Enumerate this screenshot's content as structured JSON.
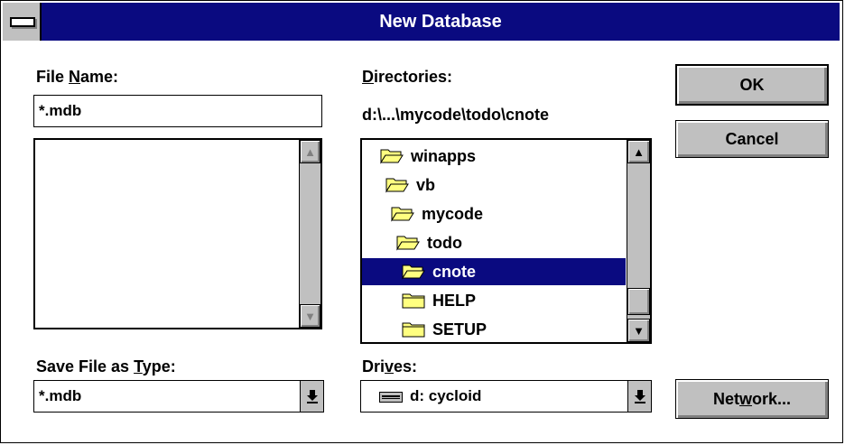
{
  "window": {
    "title": "New Database"
  },
  "file_name": {
    "label_pre": "File ",
    "label_key": "N",
    "label_post": "ame:",
    "value": "*.mdb",
    "files": []
  },
  "directories": {
    "label_key": "D",
    "label_post": "irectories:",
    "path": "d:\\...\\mycode\\todo\\cnote",
    "items": [
      {
        "name": "winapps",
        "icon": "open-folder-icon",
        "selected": false
      },
      {
        "name": "vb",
        "icon": "open-folder-icon",
        "selected": false
      },
      {
        "name": "mycode",
        "icon": "open-folder-icon",
        "selected": false
      },
      {
        "name": "todo",
        "icon": "open-folder-icon",
        "selected": false
      },
      {
        "name": "cnote",
        "icon": "open-folder-icon",
        "selected": true
      },
      {
        "name": "HELP",
        "icon": "closed-folder-icon",
        "selected": false
      },
      {
        "name": "SETUP",
        "icon": "closed-folder-icon",
        "selected": false
      }
    ]
  },
  "save_type": {
    "label_pre": "Save File as ",
    "label_key": "T",
    "label_post": "ype:",
    "value": "*.mdb"
  },
  "drives": {
    "label_pre": "Dri",
    "label_key": "v",
    "label_post": "es:",
    "value": "d: cycloid",
    "icon": "drive-icon"
  },
  "buttons": {
    "ok": "OK",
    "cancel": "Cancel",
    "network_pre": "Net",
    "network_key": "w",
    "network_post": "ork..."
  },
  "colors": {
    "titlebar": "#0a0a80",
    "face": "#c0c0c0",
    "folder": "#ffff80"
  }
}
